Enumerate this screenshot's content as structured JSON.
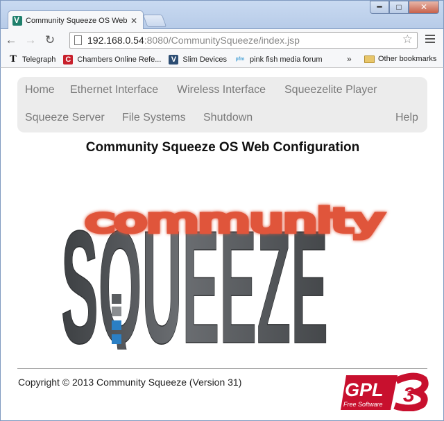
{
  "window": {
    "minimize": "━",
    "maximize": "□",
    "close": "✕"
  },
  "tab": {
    "title": "Community Squeeze OS Web",
    "close": "✕"
  },
  "toolbar": {
    "back": "←",
    "forward": "→",
    "reload": "↻",
    "url_host": "192.168.0.54",
    "url_rest": ":8080/CommunitySqueeze/index.jsp",
    "star": "☆"
  },
  "bookmarks": {
    "items": [
      {
        "icon": "T",
        "label": "Telegraph"
      },
      {
        "icon": "C",
        "label": "Chambers Online Refe..."
      },
      {
        "icon": "V",
        "label": "Slim Devices"
      },
      {
        "icon": "pfm",
        "label": "pink fish media forum"
      }
    ],
    "more": "»",
    "other": "Other bookmarks"
  },
  "nav": {
    "home": "Home",
    "ethernet": "Ethernet Interface",
    "wireless": "Wireless Interface",
    "squeezelite": "Squeezelite Player",
    "server": "Squeeze Server",
    "filesystems": "File Systems",
    "shutdown": "Shutdown",
    "help": "Help"
  },
  "page": {
    "title": "Community Squeeze OS Web Configuration",
    "logo_word": "SQUEEZE",
    "logo_overlay": "community",
    "copyright": "Copyright © 2013 Community Squeeze (Version 31)",
    "gpl_text": "GPL",
    "gpl_version": "3",
    "gpl_sub": "Free Software"
  },
  "colors": {
    "logo_gray": "#5f6266",
    "logo_overlay": "#e0553a",
    "logo_blue": "#2b7fc4",
    "gpl_red": "#c8102e"
  }
}
